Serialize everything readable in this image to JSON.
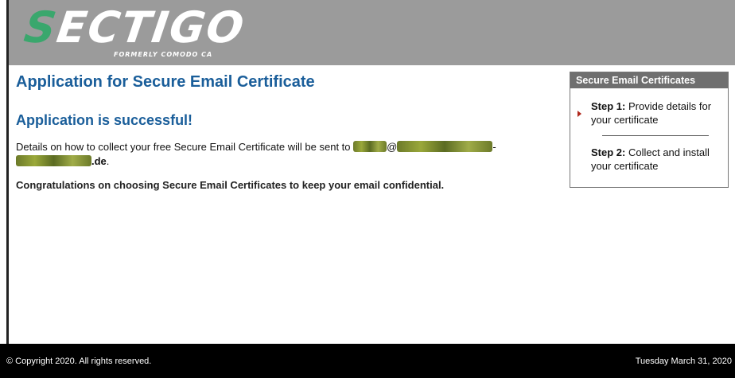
{
  "header": {
    "logo_text": "ECTIGO",
    "logo_initial": "S",
    "logo_sub": "FORMERLY COMODO CA",
    "colors": {
      "bar": "#9b9b9b",
      "logo_accent": "#3aa76d"
    }
  },
  "main": {
    "page_title": "Application for Secure Email Certificate",
    "success_title": "Application is successful!",
    "details_prefix": "Details on how to collect your free Secure Email Certificate will be sent to",
    "email_at": "@",
    "domain_suffix": ".de",
    "details_end": ".",
    "congrats": "Congratulations on choosing Secure Email Certificates to keep your email confidential."
  },
  "steps": {
    "title": "Secure Email Certificates",
    "step1_label": "Step 1:",
    "step1_text": "Provide details for your certificate",
    "step2_label": "Step 2:",
    "step2_text": "Collect and install your certificate",
    "active_step": 1
  },
  "footer": {
    "copyright": "© Copyright 2020. All rights reserved.",
    "date": "Tuesday March 31, 2020"
  }
}
